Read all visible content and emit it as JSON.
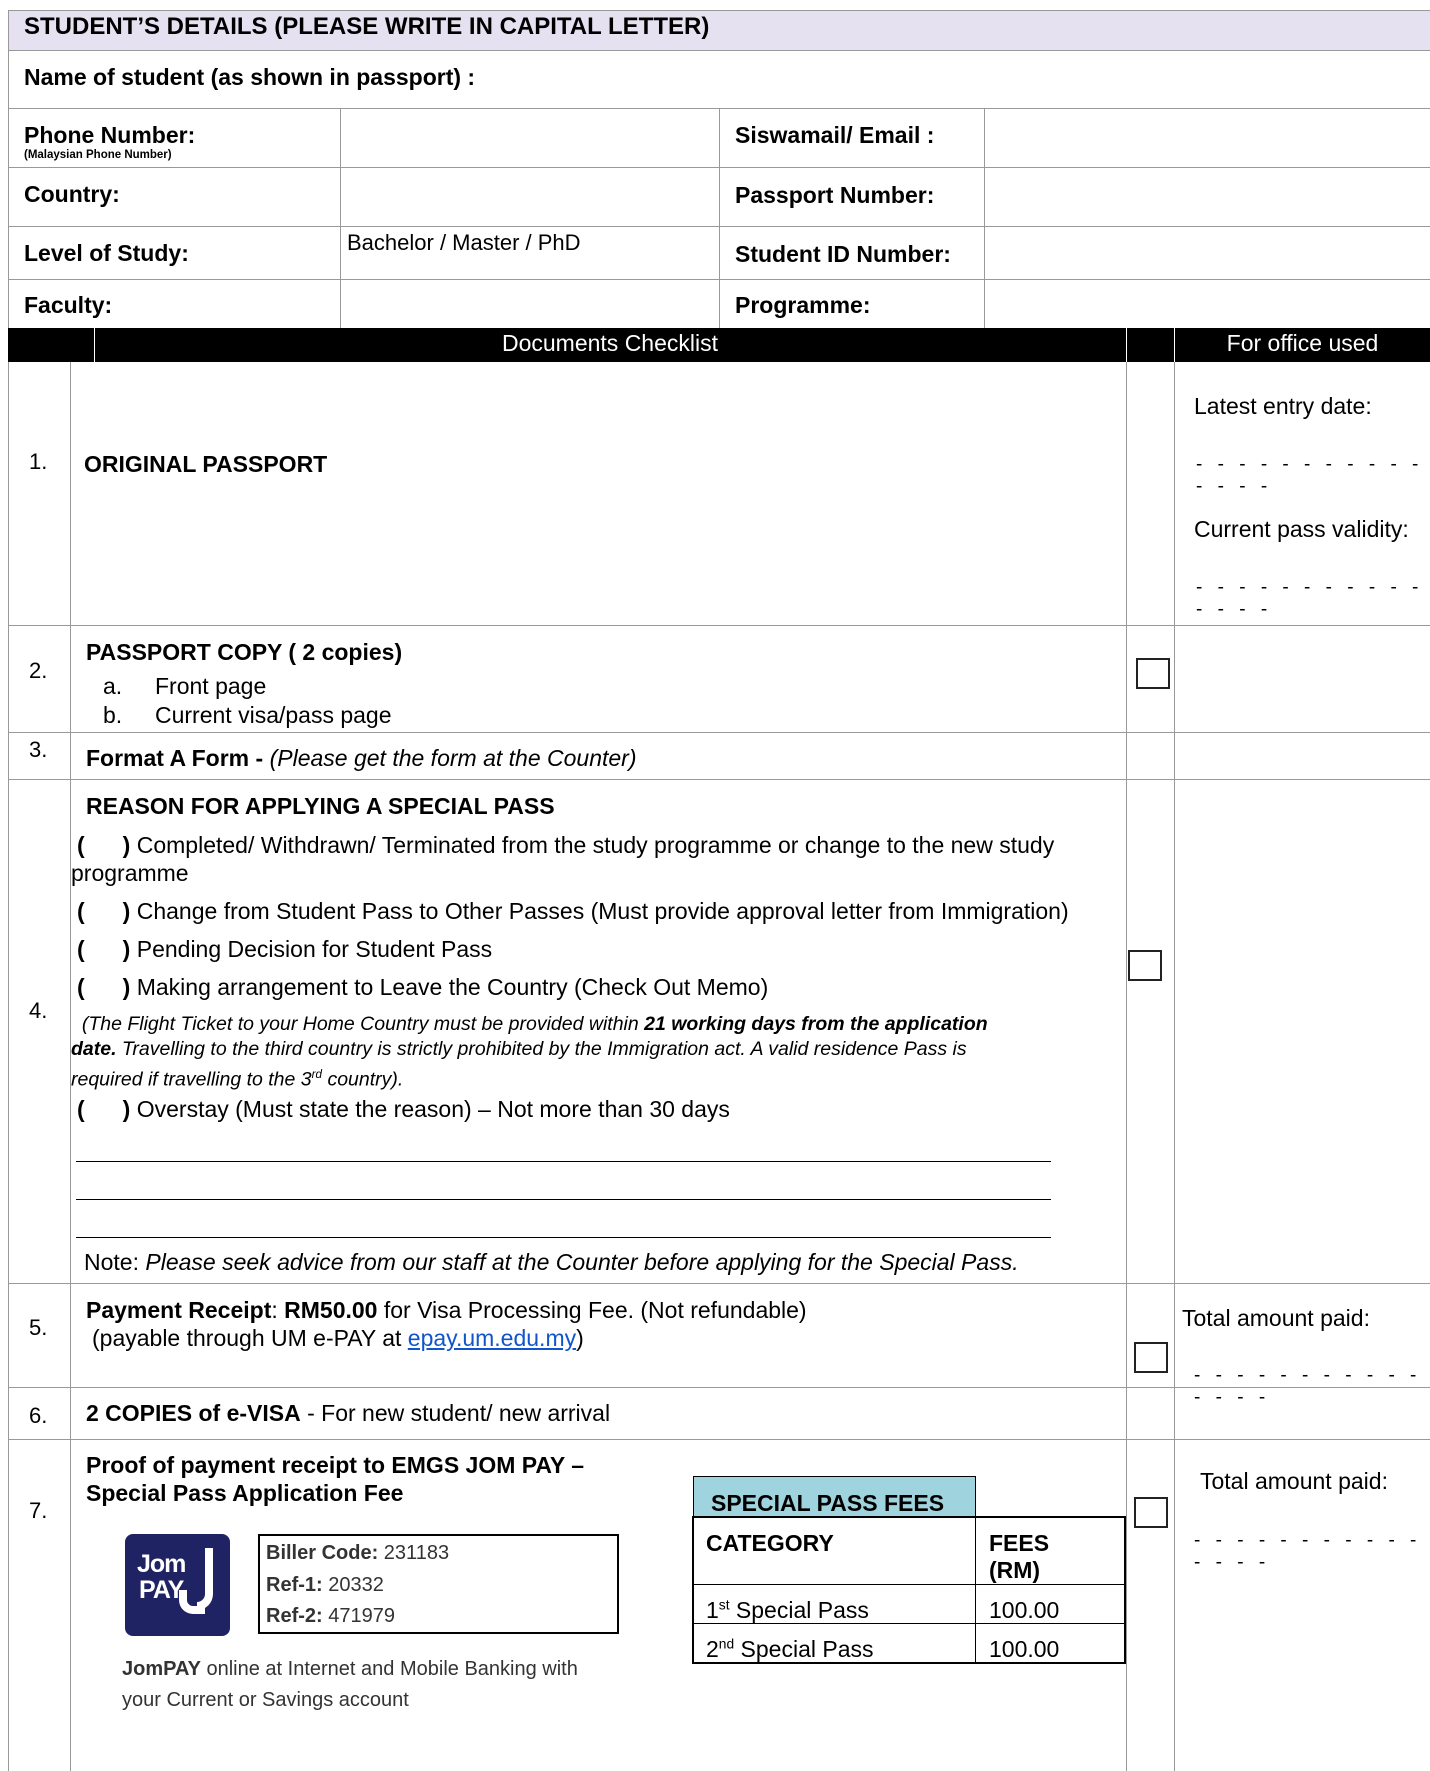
{
  "section_header": "STUDENT’S DETAILS (PLEASE WRITE IN CAPITAL LETTER)",
  "name_label": "Name of student (as shown in passport) :",
  "fields": {
    "phone_label": "Phone Number:",
    "phone_note": "(Malaysian Phone Number)",
    "email_label": "Siswamail/ Email :",
    "country_label": "Country:",
    "passport_label": "Passport Number:",
    "level_label": "Level of Study:",
    "level_value": "Bachelor / Master / PhD",
    "student_id_label": "Student ID Number:",
    "faculty_label": "Faculty:",
    "programme_label": "Programme:"
  },
  "checklist": {
    "header": "Documents Checklist",
    "office_header": "For office used",
    "item1": {
      "num": "1.",
      "title": "ORIGINAL PASSPORT",
      "office_entry": "Latest entry date:",
      "office_validity": "Current pass validity:",
      "dots": "- - - - - - - - - - - - - - -"
    },
    "item2": {
      "num": "2.",
      "title": "PASSPORT COPY ( 2 copies)",
      "sub_a_letter": "a.",
      "sub_a": "Front page",
      "sub_b_letter": "b.",
      "sub_b": "Current visa/pass page"
    },
    "item3": {
      "num": "3.",
      "title": "Format A Form - ",
      "note": "(Please get the form at the Counter)"
    },
    "item4": {
      "num": "4.",
      "title": "REASON FOR APPLYING A SPECIAL PASS",
      "bracket_open": "(",
      "bracket_close": ")",
      "reason1": "Completed/ Withdrawn/ Terminated from the study programme or change to the new study",
      "reason1_cont": "programme",
      "reason2": "Change from Student Pass to Other Passes (Must provide approval letter from Immigration)",
      "reason3": "Pending Decision for Student Pass",
      "reason4": "Making arrangement to Leave the Country (Check Out Memo)",
      "flight_note_a": "(The Flight Ticket to your Home Country must be provided within ",
      "flight_note_b": "21 working days from the application",
      "flight_note_c": "date.",
      "flight_note_d": " Travelling to the third country is strictly prohibited by the Immigration act. A valid residence Pass is",
      "flight_note_e": "required if travelling to the 3",
      "flight_note_sup": "rd",
      "flight_note_f": " country).",
      "reason5": "Overstay (Must state the reason) – Not more than 30 days",
      "note_label": "Note: ",
      "note_text": "Please seek advice from our staff at the Counter before applying for the Special Pass."
    },
    "item5": {
      "num": "5.",
      "title": "Payment Receipt",
      "colon": ": ",
      "amount": "RM50.00",
      "desc": " for Visa Processing Fee. (Not refundable)",
      "pay_prefix": "(payable through UM e-PAY at ",
      "link": "epay.um.edu.my",
      "pay_suffix": ")",
      "office_total": "Total amount paid:",
      "dots": "- - - - - - - - - - - - - - -"
    },
    "item6": {
      "num": "6.",
      "title": "2 COPIES of e-VISA",
      "desc": " - For new student/ new arrival"
    },
    "item7": {
      "num": "7.",
      "title_line1": "Proof of payment receipt to EMGS JOM PAY –",
      "title_line2": "Special Pass Application Fee",
      "logo_line1": "Jom",
      "logo_line2": "PAY",
      "biller_label": "Biller Code:",
      "biller_value": " 231183",
      "ref1_label": "Ref-1:",
      "ref1_value": " 20332",
      "ref2_label": "Ref-2:",
      "ref2_value": " 471979",
      "jompay_bold": "JomPAY",
      "jompay_text": " online at Internet and Mobile Banking with",
      "jompay_text2": "your Current or Savings account",
      "fees_title": "SPECIAL PASS FEES",
      "fees_col1": "CATEGORY",
      "fees_col2": "FEES",
      "fees_col2b": "(RM)",
      "fees_rows": [
        {
          "ord": "1",
          "sup": "st",
          "label": " Special Pass",
          "fee": "100.00"
        },
        {
          "ord": "2",
          "sup": "nd",
          "label": " Special Pass",
          "fee": "100.00"
        }
      ],
      "office_total": "Total amount paid:",
      "dots": "- - - - - - - - - - - - - - -"
    }
  },
  "colors": {
    "header_bg": "#e6e1f0",
    "fees_title_bg": "#9fd3de",
    "jompay_bg": "#1f2363",
    "link": "#1155cc"
  }
}
